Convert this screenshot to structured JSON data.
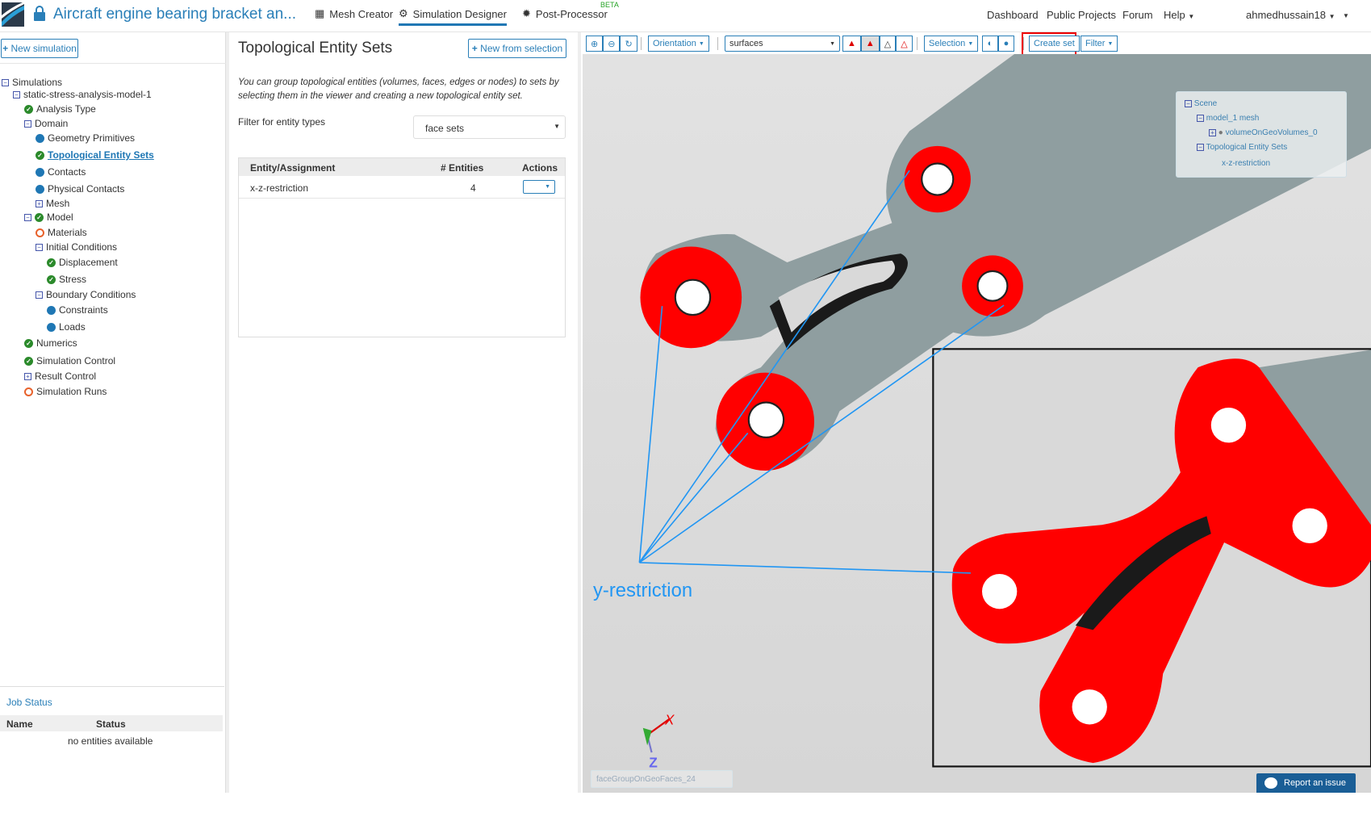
{
  "header": {
    "project_title": "Aircraft engine bearing bracket an...",
    "nav": [
      {
        "label": "Mesh Creator",
        "icon": "grid-icon"
      },
      {
        "label": "Simulation Designer",
        "icon": "gears-icon"
      },
      {
        "label": "Post-Processor",
        "icon": "gear-icon",
        "badge": "BETA"
      }
    ],
    "right_nav": [
      "Dashboard",
      "Public Projects",
      "Forum",
      "Help"
    ],
    "user": "ahmedhussain18"
  },
  "left": {
    "new_simulation": "New simulation",
    "tree": [
      {
        "label": "Simulations",
        "icon": "minus"
      },
      {
        "label": "static-stress-analysis-model-1",
        "icon": "minus"
      },
      {
        "label": "Analysis Type",
        "icon": "ok"
      },
      {
        "label": "Domain",
        "icon": "minus"
      },
      {
        "label": "Geometry Primitives",
        "icon": "dot"
      },
      {
        "label": "Topological Entity Sets",
        "icon": "ok",
        "active": true
      },
      {
        "label": "Contacts",
        "icon": "dot"
      },
      {
        "label": "Physical Contacts",
        "icon": "dot"
      },
      {
        "label": "Mesh",
        "icon": "plus"
      },
      {
        "label": "Model",
        "icon": "minus-ok"
      },
      {
        "label": "Materials",
        "icon": "ring"
      },
      {
        "label": "Initial Conditions",
        "icon": "minus"
      },
      {
        "label": "Displacement",
        "icon": "ok"
      },
      {
        "label": "Stress",
        "icon": "ok"
      },
      {
        "label": "Boundary Conditions",
        "icon": "minus"
      },
      {
        "label": "Constraints",
        "icon": "dot"
      },
      {
        "label": "Loads",
        "icon": "dot"
      },
      {
        "label": "Numerics",
        "icon": "ok"
      },
      {
        "label": "Simulation Control",
        "icon": "ok"
      },
      {
        "label": "Result Control",
        "icon": "plus"
      },
      {
        "label": "Simulation Runs",
        "icon": "ring"
      }
    ],
    "job_status": {
      "title": "Job Status",
      "columns": [
        "Name",
        "Status"
      ],
      "empty": "no entities available"
    }
  },
  "mid": {
    "title": "Topological Entity Sets",
    "new_from_selection": "New from selection",
    "description": "You can group topological entities (volumes, faces, edges or nodes) to sets by selecting them in the viewer and creating a new topological entity set.",
    "filter_label": "Filter for entity types",
    "filter_value": "face sets",
    "columns": [
      "Entity/Assignment",
      "# Entities",
      "Actions"
    ],
    "rows": [
      {
        "name": "x-z-restriction",
        "count": "4"
      }
    ]
  },
  "viewer": {
    "orientation": "Orientation",
    "render_mode": "surfaces",
    "selection": "Selection",
    "create_set": "Create set",
    "filter": "Filter",
    "scene": {
      "root": "Scene",
      "mesh": "model_1 mesh",
      "volume": "volumeOnGeoVolumes_0",
      "sets": "Topological Entity Sets",
      "set": "x-z-restriction"
    },
    "annotation": "y-restriction",
    "hover_entity": "faceGroupOnGeoFaces_24",
    "report": "Report an issue",
    "axes": {
      "x": "X",
      "z": "Z"
    },
    "colors": {
      "selected": "#ff0000",
      "body": "#8f9ea0",
      "annotation": "#2196f3"
    }
  }
}
